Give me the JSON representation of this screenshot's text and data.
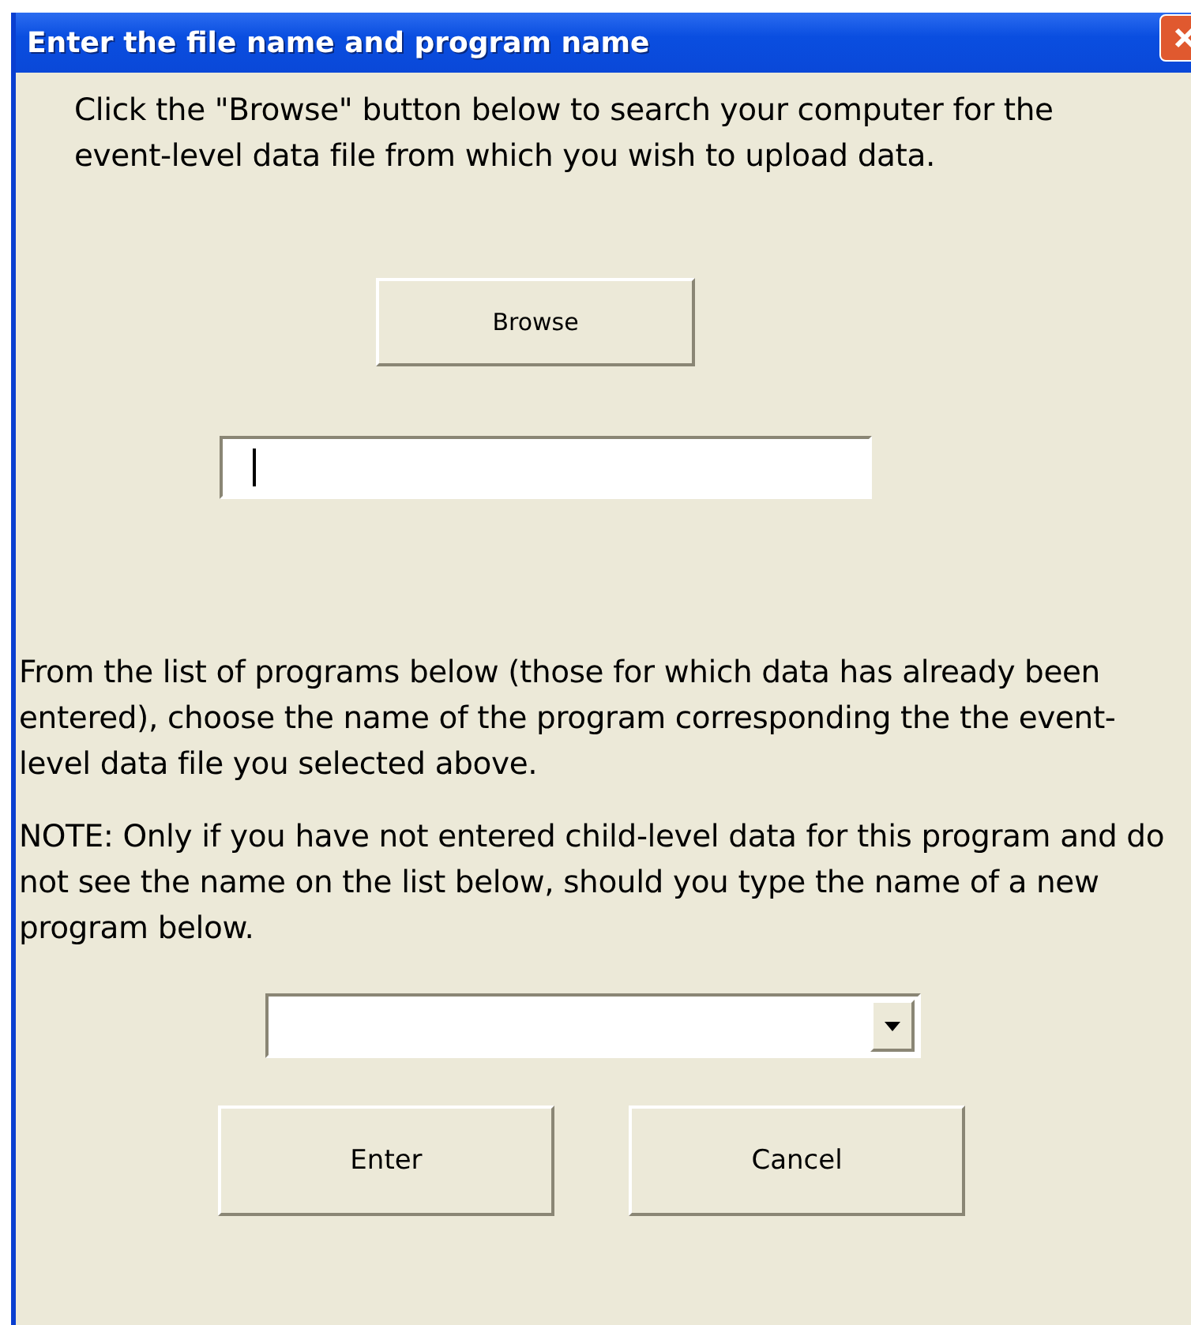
{
  "window": {
    "title": "Enter the file name and program name"
  },
  "instructions": "Click the \"Browse\" button below to search your computer for the event-level data file from which you wish to upload data.",
  "browse_button": "Browse",
  "file_field": {
    "focused": true
  },
  "program_instructions": "From the list of programs below (those for which data has already been entered), choose the name of the program corresponding the the event-level data file you selected above.",
  "note": "NOTE: Only if you have not entered child-level data for this program and do not see the name on the list below, should you type the name of a new program below.",
  "buttons": [
    "Enter",
    "Cancel"
  ]
}
